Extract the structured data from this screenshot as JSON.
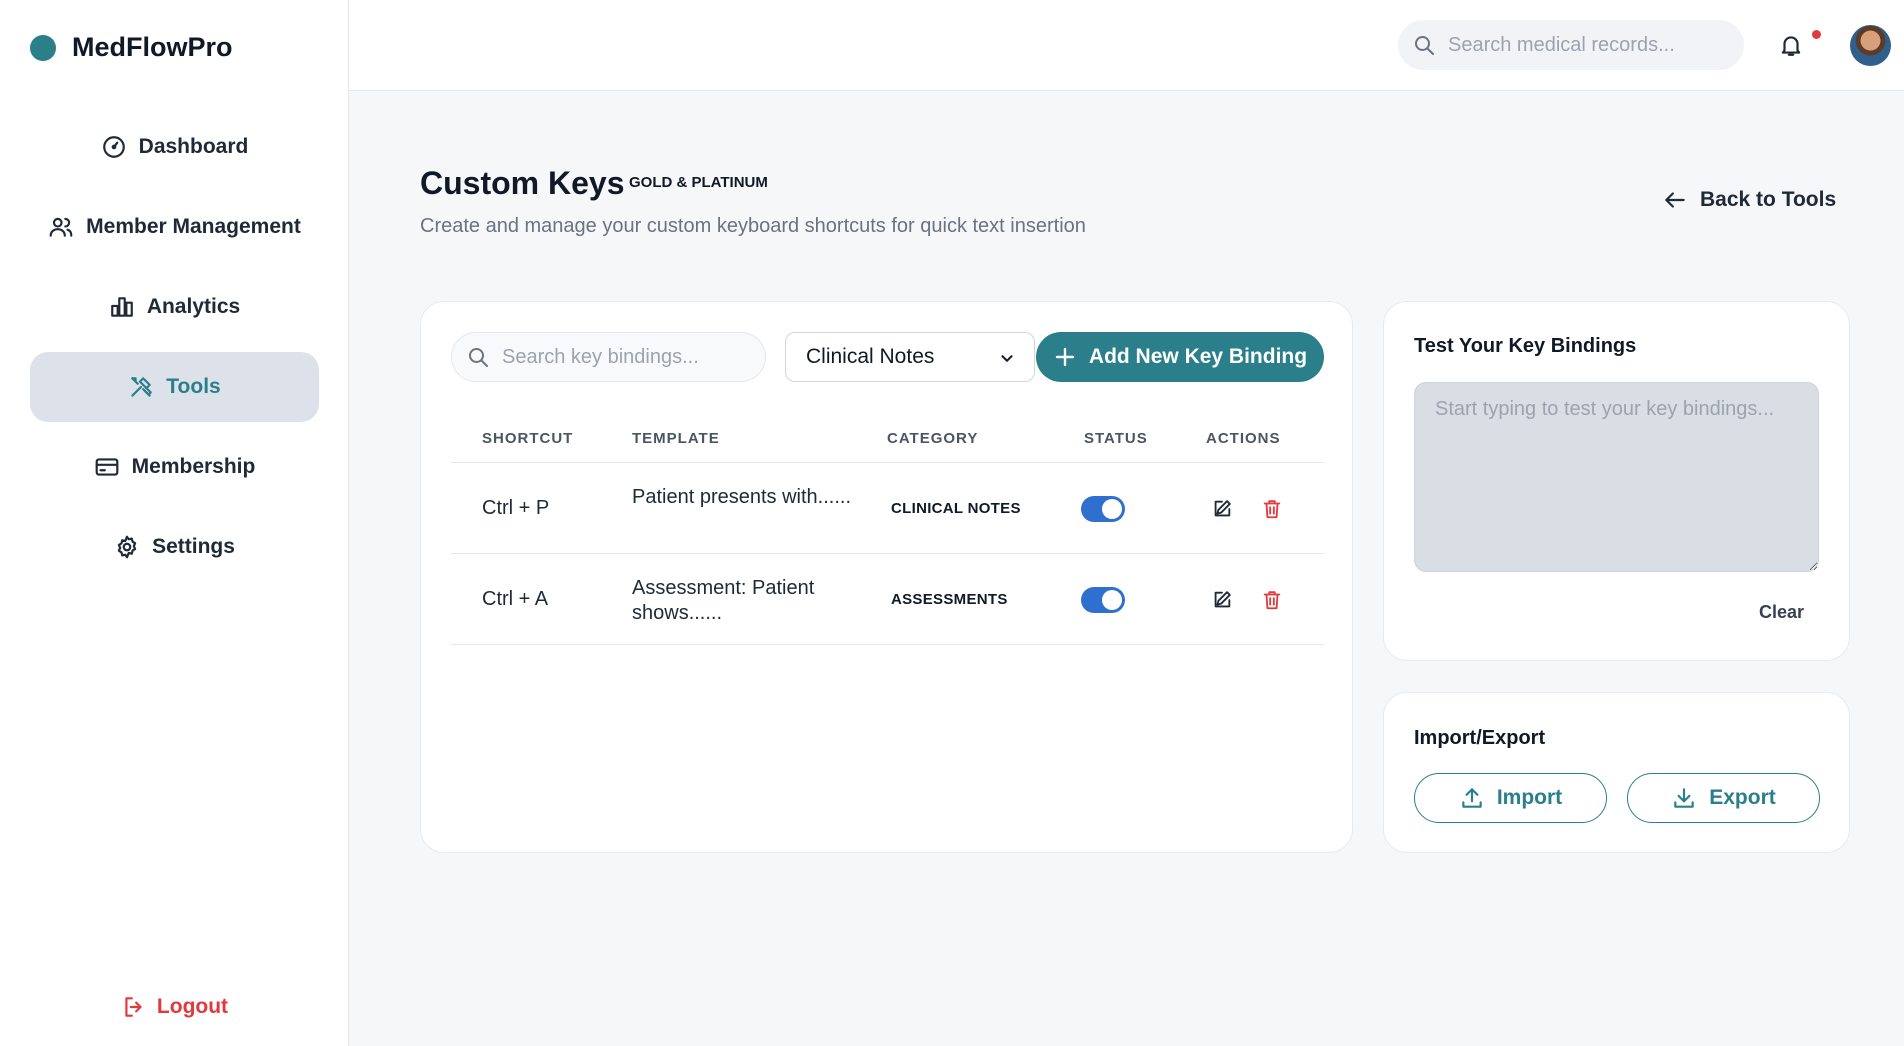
{
  "app": {
    "name": "MedFlowPro",
    "accent": "#2a7f8a"
  },
  "sidebar": {
    "items": [
      {
        "label": "Dashboard",
        "icon": "gauge-icon"
      },
      {
        "label": "Member Management",
        "icon": "users-icon"
      },
      {
        "label": "Analytics",
        "icon": "bar-chart-icon"
      },
      {
        "label": "Tools",
        "icon": "tools-icon",
        "active": true
      },
      {
        "label": "Membership",
        "icon": "card-icon"
      },
      {
        "label": "Settings",
        "icon": "gear-icon"
      }
    ],
    "logout_label": "Logout"
  },
  "topbar": {
    "search_placeholder": "Search medical records...",
    "has_notification": true
  },
  "header": {
    "title": "Custom Keys",
    "badge": "GOLD & PLATINUM",
    "subtitle": "Create and manage your custom keyboard shortcuts for quick text insertion",
    "back_label": "Back to Tools"
  },
  "toolbar": {
    "search_placeholder": "Search key bindings...",
    "category_selected": "Clinical Notes",
    "add_label": "Add New Key Binding"
  },
  "table": {
    "columns": [
      "SHORTCUT",
      "TEMPLATE",
      "CATEGORY",
      "STATUS",
      "ACTIONS"
    ],
    "rows": [
      {
        "shortcut": "Ctrl + P",
        "template": "Patient presents with......",
        "category": "CLINICAL NOTES",
        "enabled": true
      },
      {
        "shortcut": "Ctrl + A",
        "template": "Assessment: Patient shows......",
        "category": "ASSESSMENTS",
        "enabled": true
      }
    ]
  },
  "test_panel": {
    "title": "Test Your Key Bindings",
    "placeholder": "Start typing to test your key bindings...",
    "clear_label": "Clear"
  },
  "io_panel": {
    "title": "Import/Export",
    "import_label": "Import",
    "export_label": "Export"
  }
}
